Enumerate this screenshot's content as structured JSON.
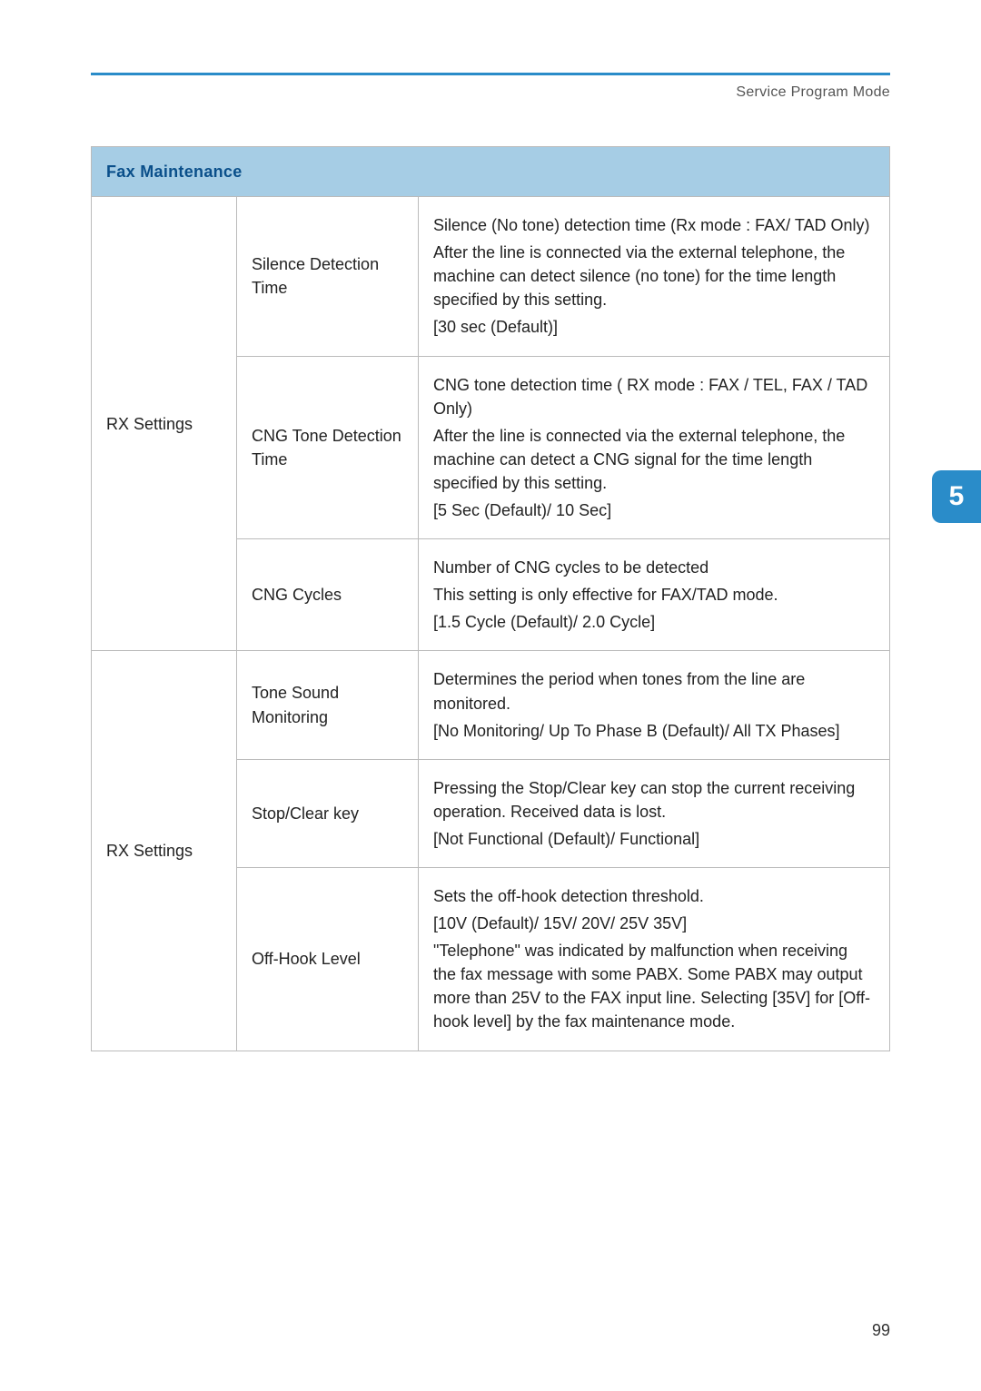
{
  "header": {
    "breadcrumb": "Service Program Mode"
  },
  "side_tab": {
    "number": "5"
  },
  "footer": {
    "page_number": "99"
  },
  "table": {
    "section_header": "Fax Maintenance",
    "groups": [
      {
        "group_label": "RX Settings",
        "rows": [
          {
            "setting": "Silence Detection Time",
            "desc": [
              "Silence (No tone) detection time (Rx mode : FAX/ TAD Only)",
              "After the line is connected via the external telephone, the machine can detect silence (no tone) for the time length specified by this setting.",
              "[30 sec (Default)]"
            ]
          },
          {
            "setting": "CNG Tone Detection Time",
            "desc": [
              "CNG tone detection time ( RX mode : FAX / TEL, FAX / TAD Only)",
              "After the line is connected via the external telephone, the machine can detect a CNG signal for the time length specified by this setting.",
              "[5 Sec (Default)/ 10 Sec]"
            ]
          },
          {
            "setting": "CNG Cycles",
            "desc": [
              "Number of CNG cycles to be detected",
              "This setting is only effective for FAX/TAD mode.",
              "[1.5 Cycle (Default)/ 2.0 Cycle]"
            ]
          }
        ]
      },
      {
        "group_label": "RX Settings",
        "rows": [
          {
            "setting": "Tone Sound Monitoring",
            "desc": [
              "Determines the period when tones from the line are monitored.",
              "[No Monitoring/ Up To Phase B (Default)/ All TX Phases]"
            ]
          },
          {
            "setting": "Stop/Clear key",
            "desc": [
              "Pressing the Stop/Clear key can stop the current receiving operation. Received data is lost.",
              "[Not Functional (Default)/ Functional]"
            ]
          },
          {
            "setting": "Off-Hook Level",
            "desc": [
              "Sets the off-hook detection threshold.",
              "[10V (Default)/ 15V/ 20V/ 25V 35V]",
              "\"Telephone\" was indicated by malfunction when receiving the fax message with some PABX. Some PABX may output more than 25V to the FAX input line. Selecting [35V] for [Off-hook level] by the fax maintenance mode."
            ]
          }
        ]
      }
    ]
  }
}
